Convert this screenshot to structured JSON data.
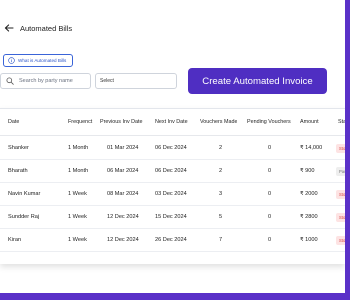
{
  "header": {
    "title": "Automated Bills"
  },
  "info_button": {
    "label": "What is Automated Bills"
  },
  "search": {
    "placeholder": "Search by party name",
    "value": ""
  },
  "filter_select": {
    "selected": "Select"
  },
  "create_button": {
    "label": "Create Automated Invoice"
  },
  "colors": {
    "accent": "#4f2ec2",
    "frame": "#5a31c8",
    "link": "#2c55c9",
    "stopped_bg": "#fde3e3",
    "stopped_text": "#d64545",
    "paused_bg": "#eeeeee",
    "paused_text": "#777777"
  },
  "table": {
    "headers": [
      "Date",
      "Frequenct",
      "Previous Inv Date",
      "Next Inv Date",
      "Vouchers Made",
      "Pending Vouchers",
      "Amount",
      "Status"
    ],
    "rows": [
      {
        "date": "Shanker",
        "freq": "1 Month",
        "prev": "01 Mar 2024",
        "next": "06 Dec 2024",
        "made": "2",
        "pending": "0",
        "amount": "₹ 14,000",
        "status": "Stopped",
        "status_kind": "stopped"
      },
      {
        "date": "Bharath",
        "freq": "1 Month",
        "prev": "06 Mar 2024",
        "next": "06 Dec 2024",
        "made": "2",
        "pending": "0",
        "amount": "₹ 900",
        "status": "Paused",
        "status_kind": "paused"
      },
      {
        "date": "Navin Kumar",
        "freq": "1 Week",
        "prev": "08 Mar 2024",
        "next": "03 Dec 2024",
        "made": "3",
        "pending": "0",
        "amount": "₹ 2000",
        "status": "Stopped",
        "status_kind": "stopped"
      },
      {
        "date": "Sundder Raj",
        "freq": "1 Week",
        "prev": "12 Dec 2024",
        "next": "15 Dec 2024",
        "made": "5",
        "pending": "0",
        "amount": "₹ 2800",
        "status": "Stopped",
        "status_kind": "stopped"
      },
      {
        "date": "Kiran",
        "freq": "1 Week",
        "prev": "12 Dec 2024",
        "next": "26 Dec 2024",
        "made": "7",
        "pending": "0",
        "amount": "₹ 1000",
        "status": "Stopped",
        "status_kind": "stopped"
      }
    ]
  }
}
